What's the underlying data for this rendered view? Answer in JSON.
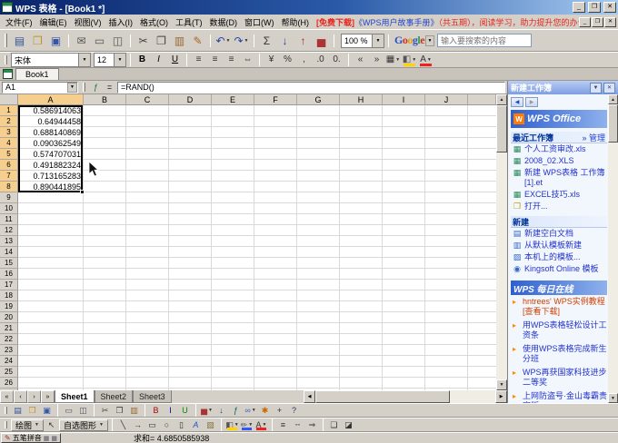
{
  "window": {
    "title": "WPS 表格 - [Book1 *]"
  },
  "glyphs": {
    "minimize": "_",
    "restore": "❐",
    "close": "✕",
    "dropdown": "▼",
    "up": "▲",
    "down": "▼",
    "left": "◀",
    "right": "▶",
    "pen": "✎",
    "grid": "▦",
    "fx": "ƒ",
    "equals": "=",
    "bullet": "▸",
    "logo_letter": "W"
  },
  "menu_bar": {
    "items": [
      "文件(F)",
      "编辑(E)",
      "视图(V)",
      "插入(I)",
      "格式(O)",
      "工具(T)",
      "数据(D)",
      "窗口(W)",
      "帮助(H)"
    ],
    "promo_free": "[免费下载]",
    "promo_book": "《WPS用户故事手册》",
    "promo_rest": "（共五期），阅读学习，助力提升您的办公效率！"
  },
  "toolbar_main": {
    "zoom_value": "100 %",
    "google": {
      "letters": [
        [
          "G",
          "#2a52c8"
        ],
        [
          "o",
          "#d03020"
        ],
        [
          "o",
          "#e8a000"
        ],
        [
          "g",
          "#2a52c8"
        ],
        [
          "l",
          "#28a048"
        ],
        [
          "e",
          "#d03020"
        ]
      ],
      "placeholder": "输入要搜索的内容"
    },
    "icons": [
      {
        "name": "new-document-icon",
        "glyph": "▤",
        "color": "#335599"
      },
      {
        "name": "open-icon",
        "glyph": "❒",
        "color": "#c89020"
      },
      {
        "name": "save-icon",
        "glyph": "▣",
        "color": "#3355aa"
      },
      {
        "sep": true
      },
      {
        "name": "email-icon",
        "glyph": "✉",
        "color": "#555555"
      },
      {
        "name": "print-icon",
        "glyph": "▭",
        "color": "#555555"
      },
      {
        "name": "print-preview-icon",
        "glyph": "◫",
        "color": "#555555"
      },
      {
        "sep": true
      },
      {
        "name": "cut-icon",
        "glyph": "✂",
        "color": "#444444"
      },
      {
        "name": "copy-icon",
        "glyph": "❐",
        "color": "#444444"
      },
      {
        "name": "paste-icon",
        "glyph": "▥",
        "color": "#996633"
      },
      {
        "name": "format-painter-icon",
        "glyph": "✎",
        "color": "#aa6622"
      },
      {
        "sep": true
      },
      {
        "name": "undo-icon",
        "glyph": "↶",
        "color": "#2244aa",
        "dd": true
      },
      {
        "name": "redo-icon",
        "glyph": "↷",
        "color": "#2244aa",
        "dd": true
      },
      {
        "sep": true
      },
      {
        "name": "autosum-icon",
        "glyph": "Σ",
        "color": "#333333"
      },
      {
        "name": "sort-ascending-icon",
        "glyph": "↓",
        "color": "#2244aa"
      },
      {
        "name": "sort-descending-icon",
        "glyph": "↑",
        "color": "#aa2222"
      },
      {
        "name": "chart-icon",
        "glyph": "▅",
        "color": "#aa3333"
      },
      {
        "sep": true
      }
    ]
  },
  "toolbar_format": {
    "font_name": "宋体",
    "font_size": "12",
    "icons": [
      {
        "name": "bold-icon",
        "glyph": "B",
        "color": "#000",
        "strong": true
      },
      {
        "name": "italic-icon",
        "glyph": "I",
        "color": "#000",
        "italic": true
      },
      {
        "name": "underline-icon",
        "glyph": "U",
        "color": "#000",
        "underline": true
      },
      {
        "sep": true
      },
      {
        "name": "align-left-icon",
        "glyph": "≡",
        "color": "#333"
      },
      {
        "name": "align-center-icon",
        "glyph": "≡",
        "color": "#333"
      },
      {
        "name": "align-right-icon",
        "glyph": "≡",
        "color": "#333"
      },
      {
        "name": "merge-center-icon",
        "glyph": "⇔",
        "color": "#333"
      },
      {
        "sep": true
      },
      {
        "name": "currency-icon",
        "glyph": "¥",
        "color": "#333"
      },
      {
        "name": "percent-icon",
        "glyph": "%",
        "color": "#333"
      },
      {
        "name": "comma-style-icon",
        "glyph": ",",
        "color": "#333"
      },
      {
        "name": "increase-decimal-icon",
        "glyph": ".0",
        "color": "#333"
      },
      {
        "name": "decrease-decimal-icon",
        "glyph": "0.",
        "color": "#333"
      },
      {
        "sep": true
      },
      {
        "name": "decrease-indent-icon",
        "glyph": "«",
        "color": "#333"
      },
      {
        "name": "increase-indent-icon",
        "glyph": "»",
        "color": "#333"
      },
      {
        "name": "borders-icon",
        "glyph": "▦",
        "color": "#333",
        "dd": true
      },
      {
        "name": "fill-color-icon",
        "glyph": "◧",
        "color": "#555",
        "bar": "#ffd400",
        "dd": true
      },
      {
        "name": "font-color-icon",
        "glyph": "A",
        "color": "#333",
        "bar": "#ee2222",
        "dd": true
      }
    ]
  },
  "doc_tab_bar": {
    "tab": "Book1"
  },
  "formula_bar": {
    "name_box": "A1",
    "formula": "=RAND()"
  },
  "grid": {
    "columns": [
      "A",
      "B",
      "C",
      "D",
      "E",
      "F",
      "G",
      "H",
      "I",
      "J"
    ],
    "row_count": 26,
    "selected_rows": 8,
    "selected_range": "A1:A8",
    "values": [
      "0.586914063",
      "0.64944458",
      "0.688140869",
      "0.090362549",
      "0.574707031",
      "0.491882324",
      "0.713165283",
      "0.890441895"
    ]
  },
  "sheet_bar": {
    "nav": [
      "«",
      "‹",
      "›",
      "»"
    ],
    "tabs": [
      "Sheet1",
      "Sheet2",
      "Sheet3"
    ],
    "active": "Sheet1"
  },
  "task_pane": {
    "title": "新建工作簿",
    "brand": "WPS Office",
    "recent_header": "最近工作簿",
    "manage_link": "» 管理",
    "recent_items": [
      {
        "label": "个人工资审改.xls",
        "icon": "spreadsheet-file-icon",
        "glyph": "▦",
        "color": "#2a8a5a"
      },
      {
        "label": "2008_02.XLS",
        "icon": "spreadsheet-file-icon",
        "glyph": "▦",
        "color": "#2a8a5a"
      },
      {
        "label": "新建 WPS表格 工作簿[1].et",
        "icon": "spreadsheet-file-icon",
        "glyph": "▦",
        "color": "#2a8a5a"
      },
      {
        "label": "EXCEL技巧.xls",
        "icon": "spreadsheet-file-icon",
        "glyph": "▦",
        "color": "#2a8a5a"
      },
      {
        "label": "打开...",
        "icon": "open-folder-icon",
        "glyph": "❒",
        "color": "#cc9900"
      }
    ],
    "new_header": "新建",
    "new_items": [
      {
        "label": "新建空白文档",
        "icon": "blank-document-icon",
        "glyph": "▤",
        "color": "#3366cc"
      },
      {
        "label": "从默认模板新建",
        "icon": "template-icon",
        "glyph": "▥",
        "color": "#3366cc"
      },
      {
        "label": "本机上的模板...",
        "icon": "local-template-icon",
        "glyph": "▨",
        "color": "#3366cc"
      },
      {
        "label": "Kingsoft Online 模板",
        "icon": "online-template-icon",
        "glyph": "◉",
        "color": "#3366cc"
      }
    ],
    "online_header": "WPS 每日在线",
    "news_items": [
      {
        "label": "hntrees' WPS实例教程[查看下载]",
        "highlight": true
      },
      {
        "label": "用WPS表格轻松设计工资条"
      },
      {
        "label": "使用WPS表格完成新生分班"
      },
      {
        "label": "WPS再获国家科技进步二等奖"
      },
      {
        "label": "上网防盗号·金山毒霸贵宾版"
      }
    ]
  },
  "bottom_toolbar": {
    "icons": [
      {
        "name": "new-icon",
        "glyph": "▤",
        "color": "#335599"
      },
      {
        "name": "open-icon",
        "glyph": "❒",
        "color": "#c89020"
      },
      {
        "name": "save-icon",
        "glyph": "▣",
        "color": "#3355aa"
      },
      {
        "sep": true
      },
      {
        "name": "print-icon",
        "glyph": "▭",
        "color": "#555566"
      },
      {
        "name": "preview-icon",
        "glyph": "◫",
        "color": "#555566"
      },
      {
        "sep": true
      },
      {
        "name": "cut-icon",
        "glyph": "✂",
        "color": "#444444"
      },
      {
        "name": "copy-icon",
        "glyph": "❐",
        "color": "#444444"
      },
      {
        "name": "paste-icon",
        "glyph": "▥",
        "color": "#996633"
      },
      {
        "sep": true
      },
      {
        "name": "bold-icon",
        "glyph": "B",
        "color": "#aa0000"
      },
      {
        "name": "italic-icon",
        "glyph": "I",
        "color": "#0000aa"
      },
      {
        "name": "underline-icon",
        "glyph": "U",
        "color": "#008800"
      },
      {
        "sep": true
      },
      {
        "name": "insert-chart-icon",
        "glyph": "▅",
        "color": "#aa3333",
        "dd": true
      },
      {
        "name": "sort-icon",
        "glyph": "↓",
        "color": "#2244aa"
      },
      {
        "name": "function-icon",
        "glyph": "ƒ",
        "color": "#006666"
      },
      {
        "name": "hyperlink-icon",
        "glyph": "∞",
        "color": "#3366cc",
        "dd": true
      },
      {
        "name": "comment-icon",
        "glyph": "✱",
        "color": "#cc6600"
      },
      {
        "name": "zoom-in-icon",
        "glyph": "+",
        "color": "#333333"
      },
      {
        "name": "help-icon",
        "glyph": "?",
        "color": "#333366"
      }
    ]
  },
  "drawing_toolbar": {
    "icons": [
      {
        "type": "label",
        "name": "draw-menu-button",
        "text": "绘图"
      },
      {
        "name": "select-objects-icon",
        "glyph": "↖",
        "color": "#333"
      },
      {
        "type": "label",
        "name": "autoshapes-menu-button",
        "text": "自选图形"
      },
      {
        "sep": true
      },
      {
        "name": "line-icon",
        "glyph": "╲",
        "color": "#333"
      },
      {
        "name": "arrow-icon",
        "glyph": "→",
        "color": "#333"
      },
      {
        "name": "rectangle-icon",
        "glyph": "▭",
        "color": "#333"
      },
      {
        "name": "oval-icon",
        "glyph": "○",
        "color": "#333"
      },
      {
        "name": "text-box-icon",
        "glyph": "▯",
        "color": "#333"
      },
      {
        "name": "word-art-icon",
        "glyph": "A",
        "color": "#2255cc",
        "italic": true
      },
      {
        "name": "insert-picture-icon",
        "glyph": "▧",
        "color": "#887744"
      },
      {
        "sep": true
      },
      {
        "name": "fill-color-icon",
        "glyph": "◧",
        "color": "#555",
        "bar": "#ffd400",
        "dd": true
      },
      {
        "name": "line-color-icon",
        "glyph": "✏",
        "color": "#555",
        "bar": "#3355ff",
        "dd": true
      },
      {
        "name": "font-color-icon",
        "glyph": "A",
        "color": "#333",
        "bar": "#ee2222",
        "dd": true
      },
      {
        "sep": true
      },
      {
        "name": "line-style-icon",
        "glyph": "≡",
        "color": "#333"
      },
      {
        "name": "dash-style-icon",
        "glyph": "╌",
        "color": "#333"
      },
      {
        "name": "arrow-style-icon",
        "glyph": "⇒",
        "color": "#333"
      },
      {
        "sep": true
      },
      {
        "name": "shadow-icon",
        "glyph": "❏",
        "color": "#333"
      },
      {
        "name": "3d-icon",
        "glyph": "◪",
        "color": "#333"
      }
    ]
  },
  "status_bar": {
    "ime_label": "五笔拼音",
    "sum_text": "求和= 4.6850585938"
  }
}
